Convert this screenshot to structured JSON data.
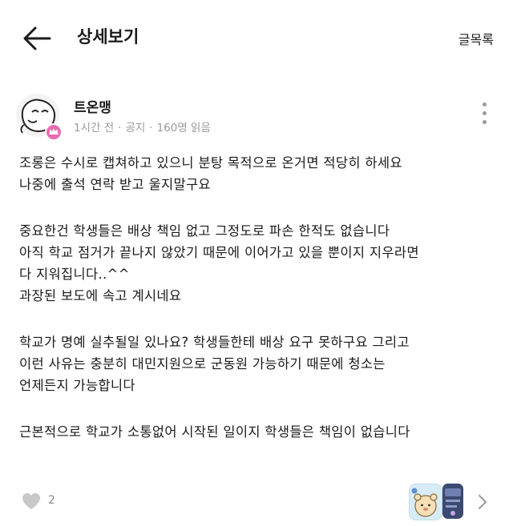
{
  "header": {
    "title": "상세보기",
    "list_label": "글목록"
  },
  "post": {
    "author": "트온맹",
    "time": "1시간 전",
    "category": "공지",
    "views": "160명 읽음",
    "paragraphs": [
      [
        "조롱은 수시로 캡쳐하고 있으니 분탕 목적으로 온거면 적당히 하세요",
        "나중에 출석 연락 받고 울지말구요"
      ],
      [
        "중요한건 학생들은 배상 책임 없고 그정도로 파손 한적도 없습니다",
        "아직 학교 점거가 끝나지 않았기 때문에 이어가고 있을 뿐이지 지우라면",
        "다 지워집니다..^^",
        "과장된 보도에 속고 계시네요"
      ],
      [
        "학교가 명예 실추될일 있나요? 학생들한테 배상 요구 못하구요 그리고",
        "이런 사유는 충분히 대민지원으로 군동원 가능하기 때문에 청소는",
        "언제든지 가능합니다"
      ],
      [
        "근본적으로 학교가 소통없어 시작된 일이지 학생들은 책임이 없습니다"
      ]
    ]
  },
  "footer": {
    "like_count": "2"
  },
  "icons": {
    "back": "arrow-left-icon",
    "more": "more-vertical-icon",
    "like": "heart-icon",
    "next": "chevron-right-icon",
    "badge": "crown-badge-icon"
  },
  "colors": {
    "badge": "#e96bb0",
    "meta_text": "#9a9a9a",
    "icon_gray": "#c8c8c8"
  }
}
